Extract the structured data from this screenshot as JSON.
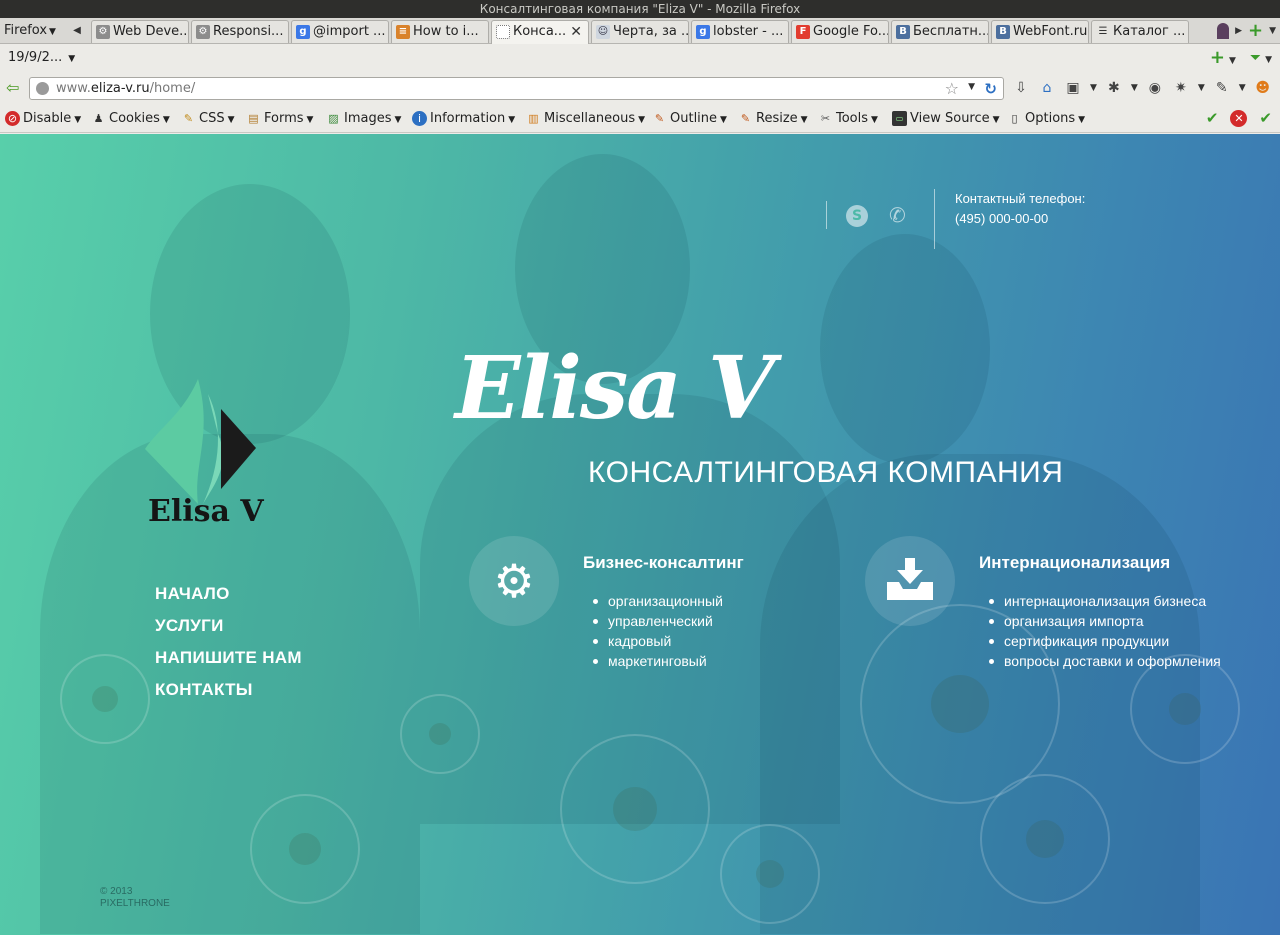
{
  "window": {
    "title": "Консалтинговая компания \"Eliza V\" - Mozilla Firefox"
  },
  "browser": {
    "menu_label": "Firefox",
    "tabs": [
      {
        "label": "Web Deve...",
        "icon": "gear-icon",
        "active": false
      },
      {
        "label": "Responsi...",
        "icon": "gear-icon",
        "active": false
      },
      {
        "label": "@import ...",
        "icon": "google-icon",
        "active": false
      },
      {
        "label": "How to i...",
        "icon": "stackoverflow-icon",
        "active": false
      },
      {
        "label": "Конса...",
        "icon": "dotted-page-icon",
        "active": true
      },
      {
        "label": "Черта, за ...",
        "icon": "user-icon",
        "active": false
      },
      {
        "label": "lobster - ...",
        "icon": "google-icon",
        "active": false
      },
      {
        "label": "Google Fo...",
        "icon": "google-fonts-icon",
        "active": false
      },
      {
        "label": "Бесплатн...",
        "icon": "vk-icon",
        "active": false
      },
      {
        "label": "WebFont.ru",
        "icon": "vk-icon",
        "active": false
      },
      {
        "label": "Каталог ...",
        "icon": "list-icon",
        "active": false
      }
    ],
    "bookmark_date": "19/9/2...",
    "url_prefix": "www.",
    "url_domain": "eliza-v.ru",
    "url_path": "/home/"
  },
  "devtoolbar": {
    "items": [
      {
        "label": "Disable",
        "icon": "disable-icon"
      },
      {
        "label": "Cookies",
        "icon": "cookies-icon"
      },
      {
        "label": "CSS",
        "icon": "css-icon"
      },
      {
        "label": "Forms",
        "icon": "forms-icon"
      },
      {
        "label": "Images",
        "icon": "images-icon"
      },
      {
        "label": "Information",
        "icon": "information-icon"
      },
      {
        "label": "Miscellaneous",
        "icon": "miscellaneous-icon"
      },
      {
        "label": "Outline",
        "icon": "outline-icon"
      },
      {
        "label": "Resize",
        "icon": "resize-icon"
      },
      {
        "label": "Tools",
        "icon": "tools-icon"
      },
      {
        "label": "View Source",
        "icon": "view-source-icon"
      },
      {
        "label": "Options",
        "icon": "options-icon"
      }
    ]
  },
  "site": {
    "contact": {
      "label": "Контактный телефон:",
      "phone": "(495) 000-00-00"
    },
    "hero": {
      "title": "Elisa V",
      "subtitle": "КОНСАЛТИНГОВАЯ КОМПАНИЯ"
    },
    "logo": {
      "text": "Elisa V"
    },
    "nav": [
      {
        "label": "НАЧАЛО"
      },
      {
        "label": "УСЛУГИ"
      },
      {
        "label": "НАПИШИТЕ НАМ"
      },
      {
        "label": "КОНТАКТЫ"
      }
    ],
    "services": [
      {
        "title": "Бизнес-консалтинг",
        "icon": "gear-icon",
        "items": [
          "организационный",
          "управленческий",
          "кадровый",
          "маркетинговый"
        ]
      },
      {
        "title": "Интернационализация",
        "icon": "inbox-download-icon",
        "items": [
          "интернационализация бизнеса",
          "организация импорта",
          "сертификация продукции",
          "вопросы доставки и оформления"
        ]
      }
    ],
    "footer": {
      "copyright": "© 2013",
      "brand": "PIXELTHRONE"
    }
  },
  "colors": {
    "gradient_start": "#58cfaa",
    "gradient_end": "#3a74b4",
    "logo_green": "#5cc9a0",
    "logo_dark": "#1b1b1b"
  }
}
